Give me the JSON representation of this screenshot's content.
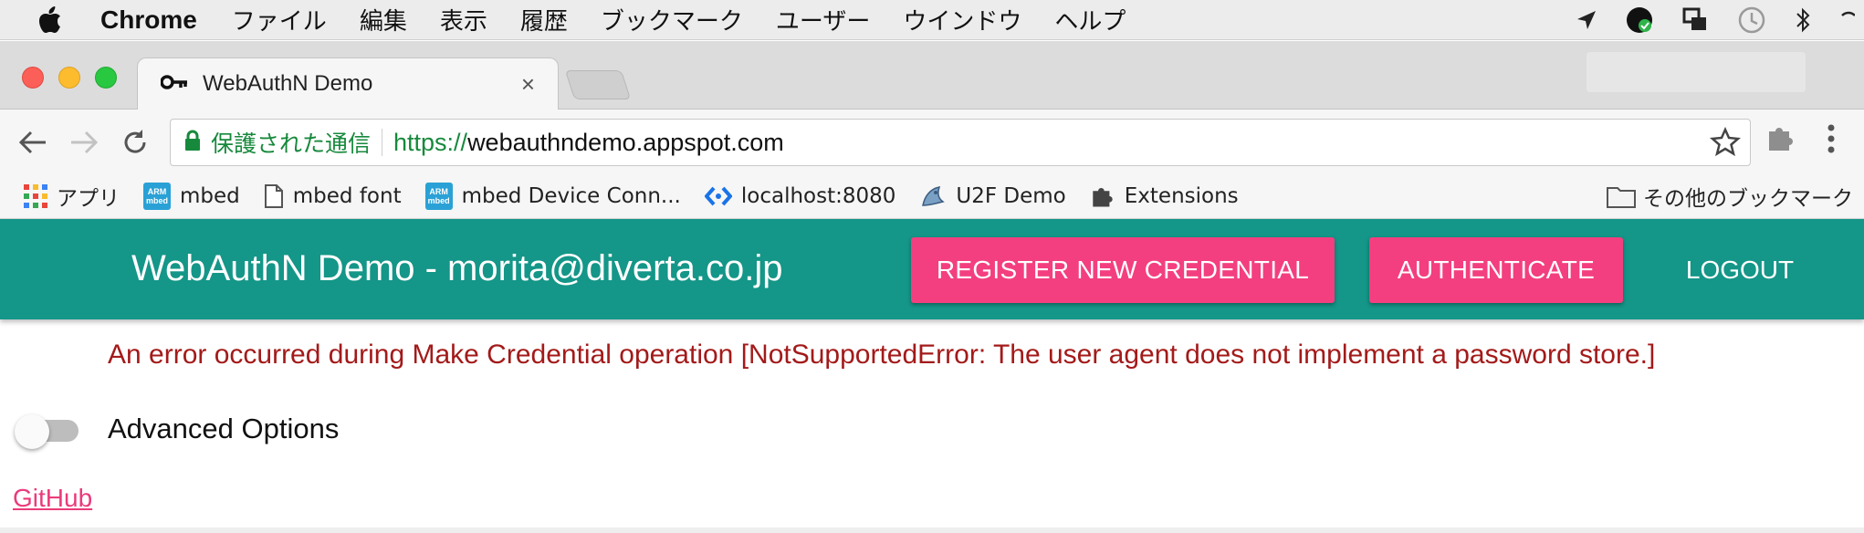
{
  "menubar": {
    "app_name": "Chrome",
    "items": [
      "ファイル",
      "編集",
      "表示",
      "履歴",
      "ブックマーク",
      "ユーザー",
      "ウインドウ",
      "ヘルプ"
    ]
  },
  "tab": {
    "title": "WebAuthN Demo",
    "close_glyph": "×"
  },
  "omnibox": {
    "secure_label": "保護された通信",
    "url_scheme": "https://",
    "url_host": "webauthndemo.appspot.com"
  },
  "bookmarks": {
    "items": [
      {
        "label": "アプリ",
        "icon": "apps-grid-icon"
      },
      {
        "label": "mbed",
        "icon": "arm-mbed-icon"
      },
      {
        "label": "mbed font",
        "icon": "page-icon"
      },
      {
        "label": "mbed Device Conn...",
        "icon": "arm-mbed-icon"
      },
      {
        "label": "localhost:8080",
        "icon": "code-icon"
      },
      {
        "label": "U2F Demo",
        "icon": "u2f-icon"
      },
      {
        "label": "Extensions",
        "icon": "puzzle-icon"
      }
    ],
    "other_label": "その他のブックマーク",
    "arm_top": "ARM",
    "arm_bottom": "mbed"
  },
  "appbar": {
    "title": "WebAuthN Demo - morita@diverta.co.jp",
    "register_label": "REGISTER NEW CREDENTIAL",
    "authenticate_label": "AUTHENTICATE",
    "logout_label": "LOGOUT"
  },
  "content": {
    "error_message": "An error occurred during Make Credential operation [NotSupportedError: The user agent does not implement a password store.]",
    "advanced_options_label": "Advanced Options",
    "advanced_options_enabled": false,
    "github_link": "GitHub"
  },
  "colors": {
    "appbar": "#149688",
    "accent": "#f33f7f",
    "error": "#a31a1a",
    "secure_green": "#17893c",
    "link": "#ea3b7a"
  }
}
